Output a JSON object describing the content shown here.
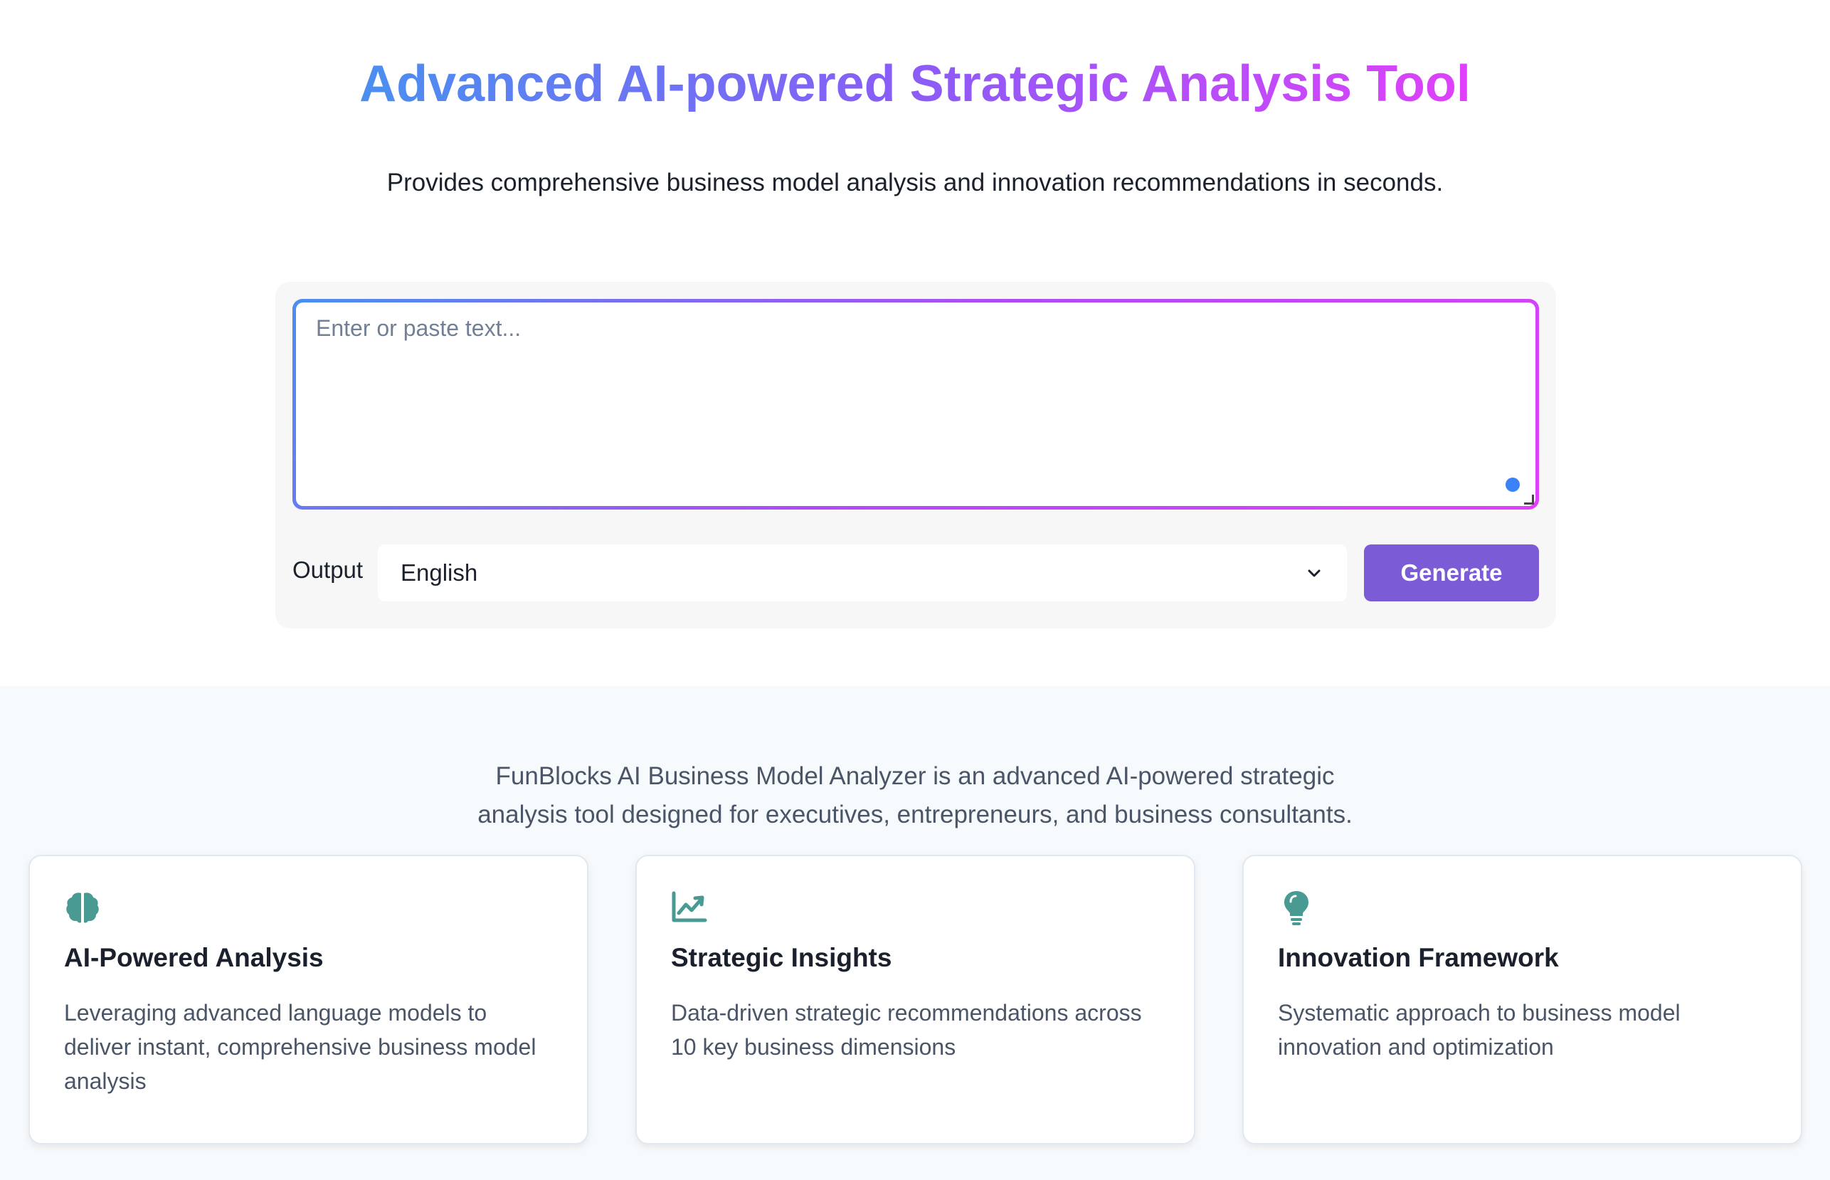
{
  "hero": {
    "title": "Advanced AI-powered Strategic Analysis Tool",
    "subtitle": "Provides comprehensive business model analysis and innovation recommendations in seconds."
  },
  "form": {
    "textarea_placeholder": "Enter or paste text...",
    "output_label": "Output",
    "language_value": "English",
    "generate_label": "Generate"
  },
  "features": {
    "intro_line1": "FunBlocks AI Business Model Analyzer is an advanced AI-powered strategic",
    "intro_line2": "analysis tool designed for executives, entrepreneurs, and business consultants.",
    "cards": [
      {
        "icon": "brain-icon",
        "title": "AI-Powered Analysis",
        "description": "Leveraging advanced language models to deliver instant, comprehensive business model analysis"
      },
      {
        "icon": "chart-line-icon",
        "title": "Strategic Insights",
        "description": "Data-driven strategic recommendations across 10 key business dimensions"
      },
      {
        "icon": "lightbulb-icon",
        "title": "Innovation Framework",
        "description": "Systematic approach to business model innovation and optimization"
      }
    ]
  },
  "colors": {
    "title_gradient_start": "#4a8ff0",
    "title_gradient_end": "#e040fb",
    "generate_button": "#7b5cd6",
    "icon_teal": "#4a9a94"
  }
}
